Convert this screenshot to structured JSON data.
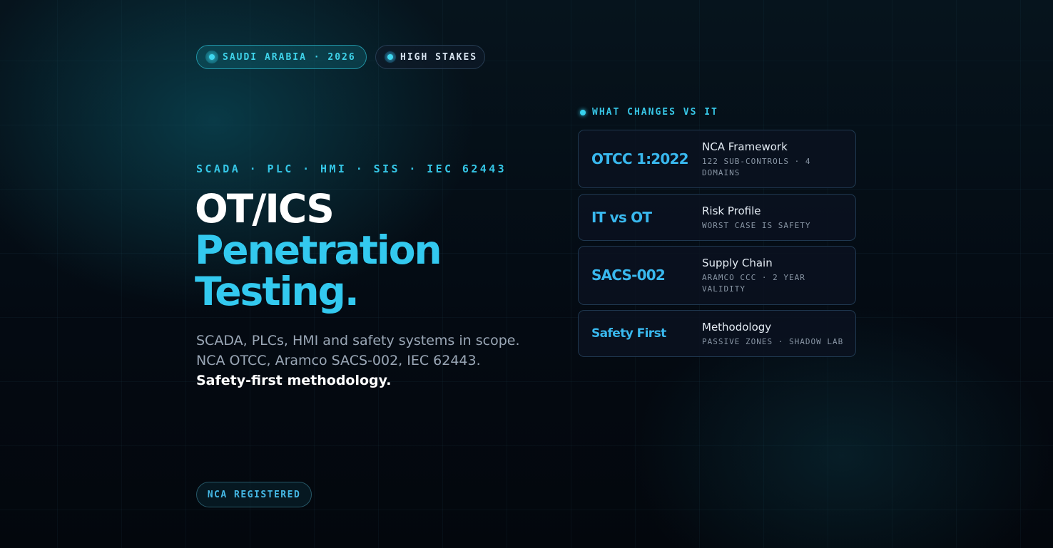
{
  "badges": [
    {
      "label": "SAUDI ARABIA · 2026"
    },
    {
      "label": "HIGH STAKES"
    }
  ],
  "hero": {
    "tagline": "SCADA · PLC · HMI · SIS · IEC 62443",
    "title_line1": "OT/ICS",
    "title_line2": "Penetration",
    "title_line3": "Testing.",
    "desc_line1": "SCADA, PLCs, HMI and safety systems in scope.",
    "desc_line2": "NCA OTCC, Aramco SACS-002, IEC 62443.",
    "desc_line3": "Safety-first methodology.",
    "registered_badge": "NCA REGISTERED"
  },
  "changes": {
    "label": "WHAT CHANGES VS IT",
    "cards": [
      {
        "code": "OTCC 1:2022",
        "title": "NCA Framework",
        "sub": "122 SUB-CONTROLS · 4 DOMAINS"
      },
      {
        "code": "IT vs OT",
        "title": "Risk Profile",
        "sub": "WORST CASE IS SAFETY"
      },
      {
        "code": "SACS-002",
        "title": "Supply Chain",
        "sub": "ARAMCO CCC · 2 YEAR VALIDITY"
      },
      {
        "code": "Safety First",
        "title": "Methodology",
        "sub": "PASSIVE ZONES · SHADOW LAB"
      }
    ]
  },
  "colors": {
    "accent": "#33c9ef",
    "background": "#040a12",
    "card_border": "#2d5a78"
  },
  "icons": [
    "status-dot-icon"
  ]
}
